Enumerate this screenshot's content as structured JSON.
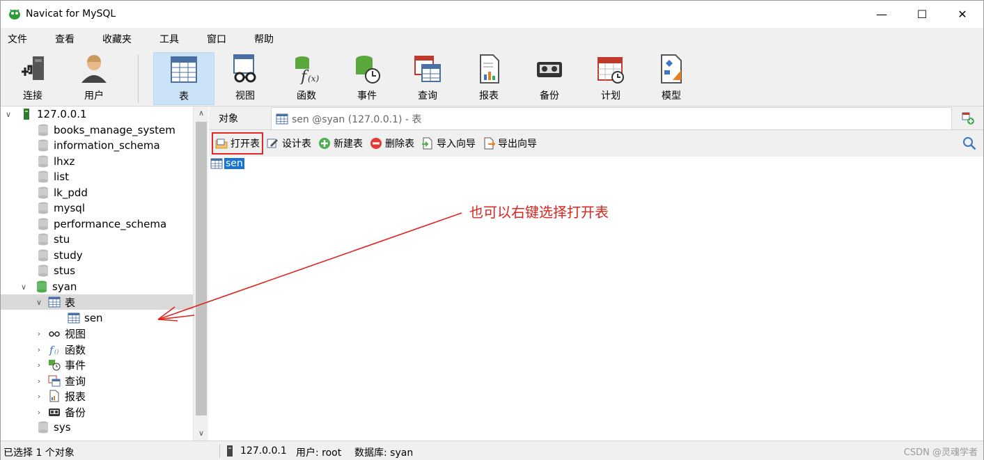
{
  "window": {
    "title": "Navicat for MySQL",
    "controls": [
      "—",
      "☐",
      "✕"
    ]
  },
  "menu": [
    "文件",
    "查看",
    "收藏夹",
    "工具",
    "窗口",
    "帮助"
  ],
  "toolbar": {
    "connect": "连接",
    "user": "用户",
    "table": "表",
    "view": "视图",
    "function": "函数",
    "event": "事件",
    "query": "查询",
    "report": "报表",
    "backup": "备份",
    "schedule": "计划",
    "model": "模型"
  },
  "tree": {
    "connection": "127.0.0.1",
    "databases": [
      "books_manage_system",
      "information_schema",
      "lhxz",
      "list",
      "lk_pdd",
      "mysql",
      "performance_schema",
      "stu",
      "study",
      "stus"
    ],
    "open_db": "syan",
    "tables_node": "表",
    "table_item": "sen",
    "sub_nodes": [
      "视图",
      "函数",
      "事件",
      "查询",
      "报表",
      "备份"
    ],
    "after": [
      "sys"
    ]
  },
  "tabs": {
    "objects": "对象",
    "doc": "sen @syan (127.0.0.1) - 表"
  },
  "objbar": {
    "open": "打开表",
    "design": "设计表",
    "new": "新建表",
    "delete": "删除表",
    "import": "导入向导",
    "export": "导出向导"
  },
  "content": {
    "item": "sen"
  },
  "annotation": "也可以右键选择打开表",
  "status": {
    "selection": "已选择 1 个对象",
    "host": "127.0.0.1",
    "user": "用户: root",
    "db": "数据库: syan",
    "watermark": "CSDN @灵魂学者"
  },
  "colors": {
    "accent": "#1874d3",
    "annotation": "#e0241e",
    "toolbar_bg": "#f0f0f0",
    "active_tool": "#cce3f7"
  }
}
